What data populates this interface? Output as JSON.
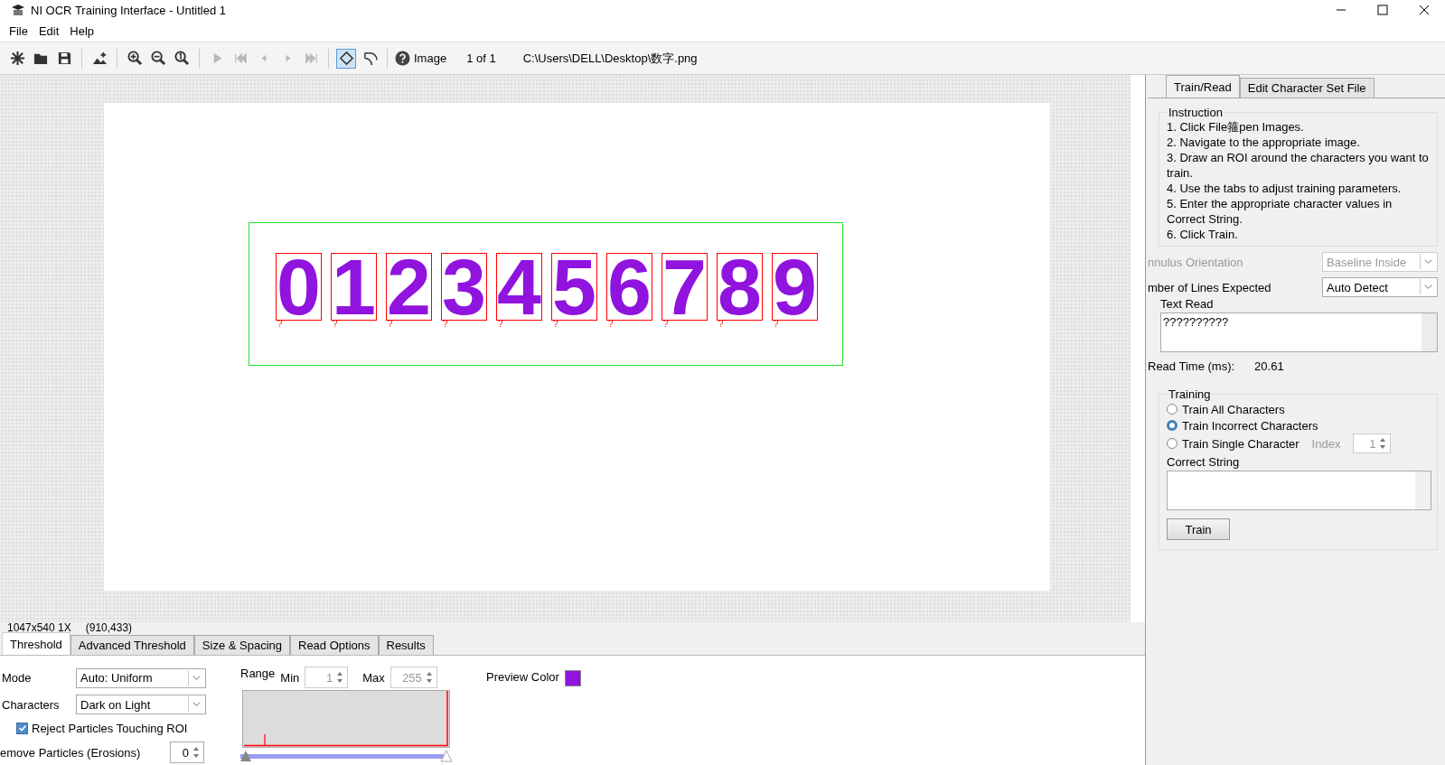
{
  "window": {
    "title": "NI OCR Training Interface - Untitled 1"
  },
  "menu": [
    "File",
    "Edit",
    "Help"
  ],
  "toolbar": {
    "tools": [
      {
        "kind": "new",
        "disabled": false,
        "selected": false
      },
      {
        "kind": "open",
        "disabled": false,
        "selected": false
      },
      {
        "kind": "save",
        "disabled": false,
        "selected": false
      },
      {
        "kind": "sep"
      },
      {
        "kind": "add-image",
        "disabled": false,
        "selected": false
      },
      {
        "kind": "sep"
      },
      {
        "kind": "zoom-in",
        "disabled": false,
        "selected": false
      },
      {
        "kind": "zoom-out",
        "disabled": false,
        "selected": false
      },
      {
        "kind": "zoom-fit",
        "disabled": false,
        "selected": false
      },
      {
        "kind": "sep"
      },
      {
        "kind": "play",
        "disabled": true,
        "selected": false
      },
      {
        "kind": "first",
        "disabled": true,
        "selected": false
      },
      {
        "kind": "prev",
        "disabled": true,
        "selected": false
      },
      {
        "kind": "next",
        "disabled": true,
        "selected": false
      },
      {
        "kind": "last",
        "disabled": true,
        "selected": false
      },
      {
        "kind": "sep"
      },
      {
        "kind": "rotated-rect",
        "disabled": false,
        "selected": true
      },
      {
        "kind": "annulus",
        "disabled": false,
        "selected": false
      },
      {
        "kind": "sep"
      }
    ],
    "image_label": "Image",
    "page": "1 of 1",
    "path": "C:\\Users\\DELL\\Desktop\\数字.png"
  },
  "canvas": {
    "characters": [
      {
        "glyph": "0",
        "result": "?"
      },
      {
        "glyph": "1",
        "result": "?"
      },
      {
        "glyph": "2",
        "result": "?"
      },
      {
        "glyph": "3",
        "result": "?"
      },
      {
        "glyph": "4",
        "result": "?"
      },
      {
        "glyph": "5",
        "result": "?"
      },
      {
        "glyph": "6",
        "result": "?"
      },
      {
        "glyph": "7",
        "result": "?"
      },
      {
        "glyph": "8",
        "result": "?"
      },
      {
        "glyph": "9",
        "result": "?"
      }
    ]
  },
  "status": {
    "size": "1047x540 1X",
    "cursor": "(910,433)"
  },
  "bottom_tabs": [
    {
      "label": "Threshold",
      "selected": true
    },
    {
      "label": "Advanced Threshold",
      "selected": false
    },
    {
      "label": "Size & Spacing",
      "selected": false
    },
    {
      "label": "Read Options",
      "selected": false
    },
    {
      "label": "Results",
      "selected": false
    }
  ],
  "threshold": {
    "mode_label": "Mode",
    "mode": "Auto: Uniform",
    "characters_label": "Characters",
    "characters": "Dark on Light",
    "reject": {
      "label": "Reject Particles Touching ROI",
      "checked": true
    },
    "erosions_label": "emove Particles (Erosions)",
    "erosions": "0",
    "range_label": "Range",
    "min_label": "Min",
    "min": "1",
    "max_label": "Max",
    "max": "255",
    "range_disabled": true,
    "range_low": {
      "level": 0
    },
    "range_high": {
      "level": 1
    },
    "preview_label": "Preview Color"
  },
  "side_tabs": [
    {
      "label": "Train/Read",
      "selected": true
    },
    {
      "label": "Edit Character Set File",
      "selected": false
    }
  ],
  "instruction": {
    "title": "Instruction",
    "lines": [
      "1. Click File箍pen Images.",
      "2. Navigate to the appropriate image.",
      "3. Draw an ROI around the characters you want to train.",
      "4. Use the tabs to adjust training parameters.",
      "5. Enter the appropriate character values in Correct String.",
      "6. Click Train."
    ]
  },
  "annulus": {
    "label": "nnulus Orientation",
    "value": "Baseline Inside",
    "disabled": true
  },
  "lines_expected": {
    "label": "mber of Lines Expected",
    "value": "Auto Detect",
    "disabled": false
  },
  "text_read": {
    "label": "Text Read",
    "value": "??????????"
  },
  "read_time": {
    "label": "Read Time (ms):",
    "value": "20.61"
  },
  "training": {
    "title": "Training",
    "options": [
      {
        "label": "Train All Characters",
        "selected": false
      },
      {
        "label": "Train Incorrect Characters",
        "selected": true
      },
      {
        "label": "Train Single Character",
        "selected": false
      }
    ],
    "index_label": "Index",
    "index": "1",
    "index_disabled": true,
    "correct_label": "Correct String",
    "button": "Train"
  }
}
